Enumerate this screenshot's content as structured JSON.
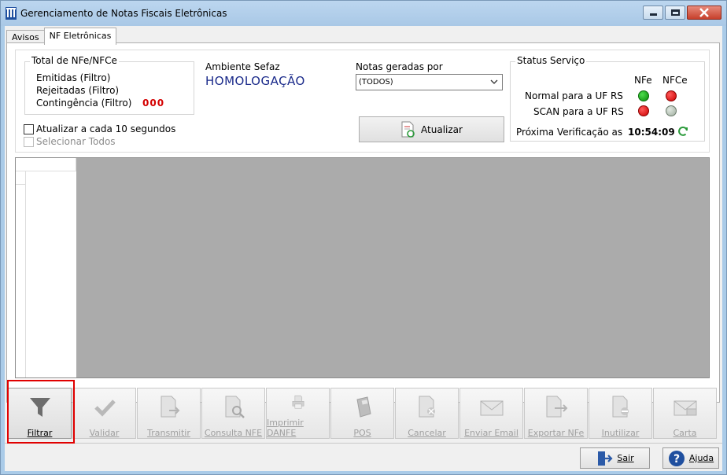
{
  "window": {
    "title": "Gerenciamento de Notas Fiscais Eletrônicas"
  },
  "tabs": [
    {
      "label": "Avisos",
      "active": false
    },
    {
      "label": "NF Eletrônicas",
      "active": true
    }
  ],
  "totals": {
    "title": "Total de NFe/NFCe",
    "emitidas": "Emitidas (Filtro)",
    "rejeitadas": "Rejeitadas (Filtro)",
    "contingencia": "Contingência (Filtro)",
    "contingencia_count": "000"
  },
  "ambiente": {
    "label": "Ambiente Sefaz",
    "value": "HOMOLOGAÇÃO"
  },
  "notas": {
    "label": "Notas geradas por",
    "selected": "(TODOS)"
  },
  "checkboxes": {
    "atualizar": "Atualizar a cada 10 segundos",
    "selecionar": "Selecionar Todos"
  },
  "atualizar_button": "Atualizar",
  "status": {
    "title": "Status Serviço",
    "col_nfe": "NFe",
    "col_nfce": "NFCe",
    "row_normal": "Normal para a UF RS",
    "row_scan": "SCAN para a UF RS",
    "normal_nfe": "green",
    "normal_nfce": "red",
    "scan_nfe": "red",
    "scan_nfce": "gray",
    "next_check_label": "Próxima Verificação as",
    "next_check_time": "10:54:09"
  },
  "toolbar": {
    "filtrar": "Filtrar",
    "validar": "Validar",
    "transmitir": "Transmitir",
    "consulta": "Consulta NFE",
    "imprimir": "Imprimir DANFE",
    "pos": "POS",
    "cancelar": "Cancelar",
    "enviar_email": "Enviar Email",
    "exportar": "Exportar NFe",
    "inutilizar": "Inutilizar",
    "carta": "Carta"
  },
  "footer": {
    "sair": "Sair",
    "ajuda": "Ajuda"
  }
}
